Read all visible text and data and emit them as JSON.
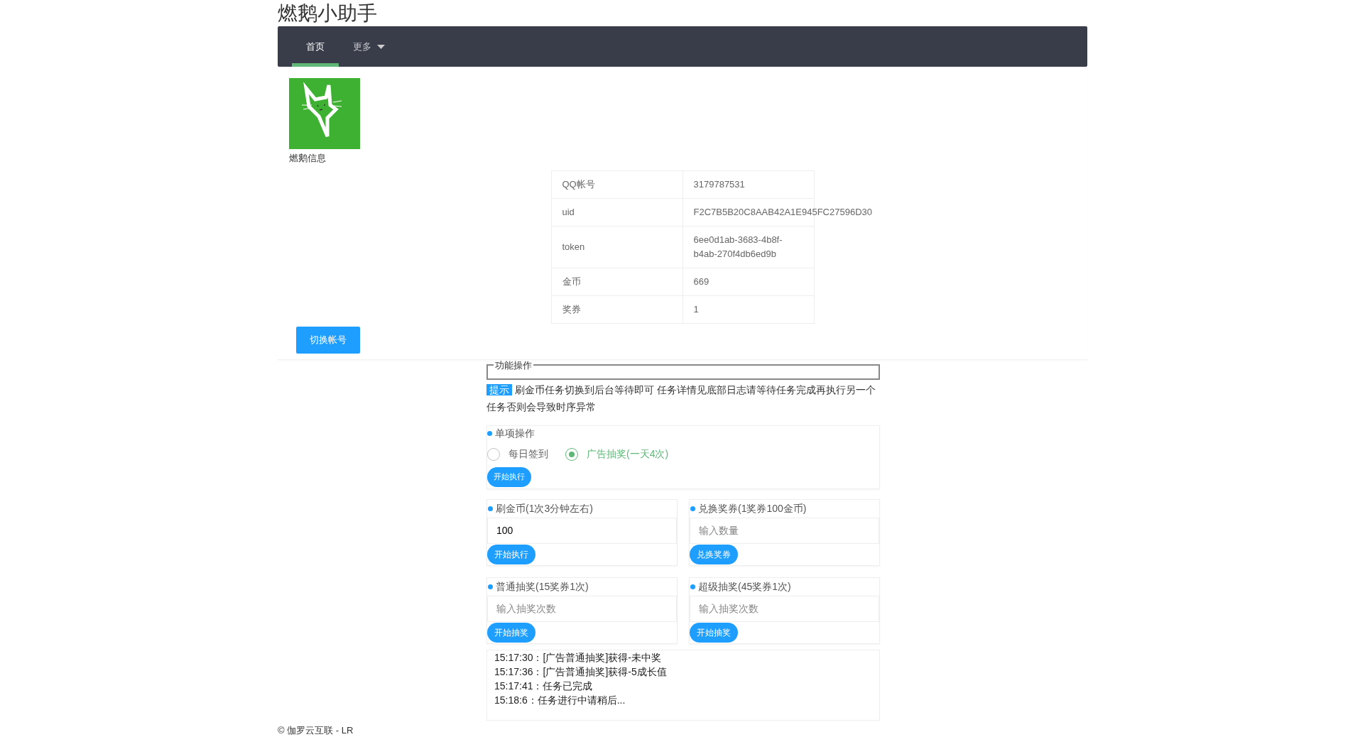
{
  "app_title": "燃鹅小助手",
  "nav": [
    {
      "label": "首页",
      "selected": true,
      "dropdown": false
    },
    {
      "label": "更多",
      "selected": false,
      "dropdown": true
    }
  ],
  "profile": {
    "label": "燃鹅信息"
  },
  "info_table": {
    "rows": [
      {
        "label": "QQ帐号",
        "value": "3179787531"
      },
      {
        "label": "uid",
        "value": "F2C7B5B20C8AAB42A1E945FC27596D30"
      },
      {
        "label": "token",
        "value": "6ee0d1ab-3683-4b8f-b4ab-270f4db6ed9b"
      },
      {
        "label": "金币",
        "value": "669"
      },
      {
        "label": "奖券",
        "value": "1"
      }
    ]
  },
  "switch_button": "切换帐号",
  "fieldset_legend": "功能操作",
  "notice": {
    "badge": "提示",
    "text": "刷金币任务切换到后台等待即可 任务详情见底部日志请等待任务完成再执行另一个任务否则会导致时序异常"
  },
  "single_ops": {
    "title": "单项操作",
    "options": [
      {
        "label": "每日签到",
        "selected": false
      },
      {
        "label": "广告抽奖(一天4次)",
        "selected": true
      }
    ],
    "button": "开始执行"
  },
  "cards": [
    {
      "title": "刷金币(1次3分钟左右)",
      "value": "100",
      "button": "开始执行"
    },
    {
      "title": "兑换奖券(1奖券100金币)",
      "placeholder": "输入数量",
      "button": "兑换奖券"
    },
    {
      "title": "普通抽奖(15奖券1次)",
      "placeholder": "输入抽奖次数",
      "button": "开始抽奖"
    },
    {
      "title": "超级抽奖(45奖券1次)",
      "placeholder": "输入抽奖次数",
      "button": "开始抽奖"
    }
  ],
  "log": [
    "15:17:30：[广告普通抽奖]获得-未中奖",
    "15:17:36：[广告普通抽奖]获得-5成长值",
    "15:17:41：任务已完成",
    "15:18:6：任务进行中请稍后..."
  ],
  "footer": "© 伽罗云互联 - LR"
}
